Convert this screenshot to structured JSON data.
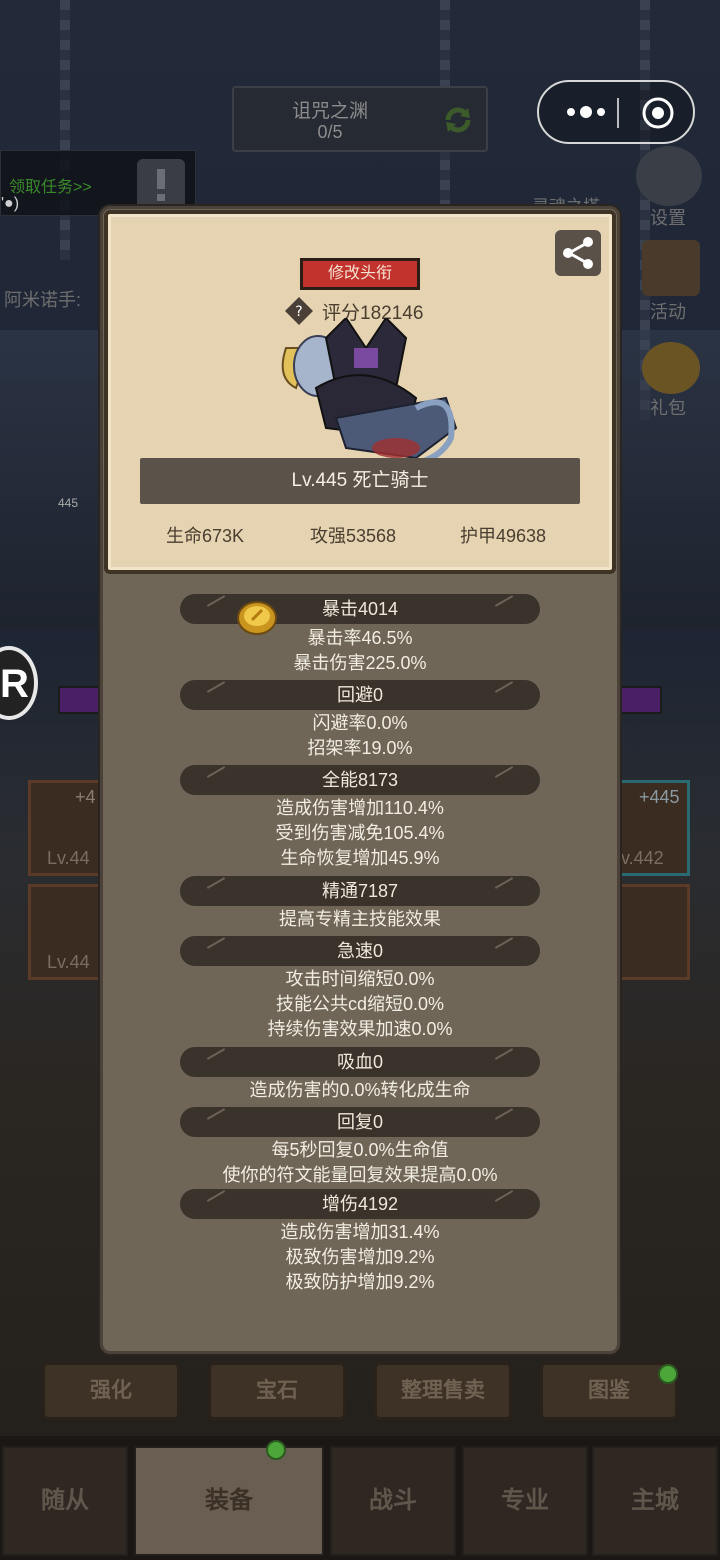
{
  "background": {
    "dungeon": {
      "name": "诅咒之渊",
      "progress": "0/5"
    },
    "task": {
      "label": "领取任务>>",
      "sub": "'●)"
    },
    "side_text": "阿米诺手:",
    "side_buttons": [
      {
        "label": "灵魂之塔"
      },
      {
        "label": "设置"
      },
      {
        "label": "活动"
      },
      {
        "label": "礼包"
      }
    ],
    "slot_plus_left": "+4",
    "slot_plus_right": "+445",
    "slot_lv_left_top": "Lv.44",
    "slot_lv_left_bottom": "Lv.44",
    "slot_lv_right": "v.442",
    "small_level": "445",
    "logo_letter": "R",
    "action_buttons": [
      "强化",
      "宝石",
      "整理售卖",
      "图鉴"
    ],
    "nav": [
      "随从",
      "装备",
      "战斗",
      "专业",
      "主城"
    ]
  },
  "card": {
    "rename_label": "修改头衔",
    "score": "评分182146",
    "level_name": "Lv.445 死亡骑士",
    "hp": "生命673K",
    "attack": "攻强53568",
    "armor": "护甲49638"
  },
  "stats": [
    {
      "header": "暴击4014",
      "lines": [
        "暴击率46.5%",
        "暴击伤害225.0%"
      ]
    },
    {
      "header": "回避0",
      "lines": [
        "闪避率0.0%",
        "招架率19.0%"
      ]
    },
    {
      "header": "全能8173",
      "lines": [
        "造成伤害增加110.4%",
        "受到伤害减免105.4%",
        "生命恢复增加45.9%"
      ]
    },
    {
      "header": "精通7187",
      "lines": [
        "提高专精主技能效果"
      ]
    },
    {
      "header": "急速0",
      "lines": [
        "攻击时间缩短0.0%",
        "技能公共cd缩短0.0%",
        "持续伤害效果加速0.0%"
      ]
    },
    {
      "header": "吸血0",
      "lines": [
        "造成伤害的0.0%转化成生命"
      ]
    },
    {
      "header": "回复0",
      "lines": [
        "每5秒回复0.0%生命值",
        "使你的符文能量回复效果提高0.0%"
      ]
    },
    {
      "header": "增伤4192",
      "lines": [
        "造成伤害增加31.4%",
        "极致伤害增加9.2%",
        "极致防护增加9.2%"
      ]
    }
  ]
}
